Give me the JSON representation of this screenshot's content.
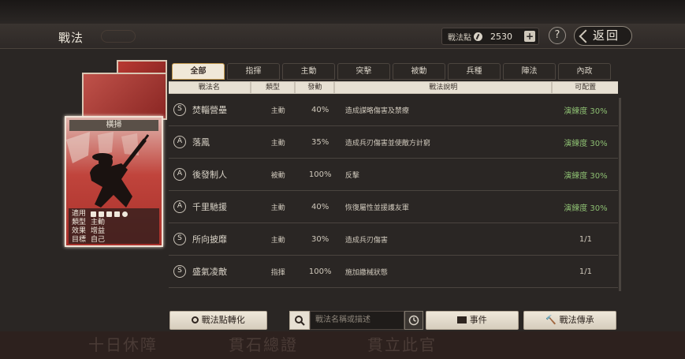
{
  "header": {
    "title": "戰法",
    "points_label": "戰法點",
    "points_value": "2530",
    "help_label": "?",
    "back_label": "返回"
  },
  "card": {
    "name": "橫掃",
    "info": [
      {
        "key": "適用",
        "value": ""
      },
      {
        "key": "類型",
        "value": "主動"
      },
      {
        "key": "效果",
        "value": "增益"
      },
      {
        "key": "目標",
        "value": "自己"
      }
    ]
  },
  "tabs": [
    {
      "label": "全部",
      "active": true
    },
    {
      "label": "指揮",
      "active": false
    },
    {
      "label": "主動",
      "active": false
    },
    {
      "label": "突擊",
      "active": false
    },
    {
      "label": "被動",
      "active": false
    },
    {
      "label": "兵種",
      "active": false
    },
    {
      "label": "陣法",
      "active": false
    },
    {
      "label": "內政",
      "active": false
    }
  ],
  "table": {
    "headers": [
      "戰法名",
      "類型",
      "發動",
      "戰法說明",
      "可配置"
    ],
    "rows": [
      {
        "rank": "S",
        "name": "焚輜營壘",
        "type": "主動",
        "rate": "40%",
        "desc": "造成謀略傷害及禁療",
        "config": "演練度 30%",
        "config_green": true
      },
      {
        "rank": "A",
        "name": "落鳳",
        "type": "主動",
        "rate": "35%",
        "desc": "造成兵刃傷害並使敵方計窮",
        "config": "演練度 30%",
        "config_green": true
      },
      {
        "rank": "A",
        "name": "後發制人",
        "type": "被動",
        "rate": "100%",
        "desc": "反擊",
        "config": "演練度 30%",
        "config_green": true
      },
      {
        "rank": "A",
        "name": "千里馳援",
        "type": "主動",
        "rate": "40%",
        "desc": "恢復屬性並援護友軍",
        "config": "演練度 30%",
        "config_green": true
      },
      {
        "rank": "S",
        "name": "所向披靡",
        "type": "主動",
        "rate": "30%",
        "desc": "造成兵刃傷害",
        "config": "1/1",
        "config_green": false
      },
      {
        "rank": "S",
        "name": "盛氣凌敵",
        "type": "指揮",
        "rate": "100%",
        "desc": "施加繳械狀態",
        "config": "1/1",
        "config_green": false
      }
    ]
  },
  "bottom": {
    "convert_label": "戰法點轉化",
    "search_placeholder": "戰法名稱或描述",
    "event_label": "事件",
    "inherit_label": "戰法傳承",
    "bg_text": [
      "十日休障",
      "貫石總證",
      "貫立此官"
    ]
  },
  "colors": {
    "accent_green": "#8dbf72",
    "card_red": "#c0443c",
    "tab_active_border": "#c69b4e"
  }
}
